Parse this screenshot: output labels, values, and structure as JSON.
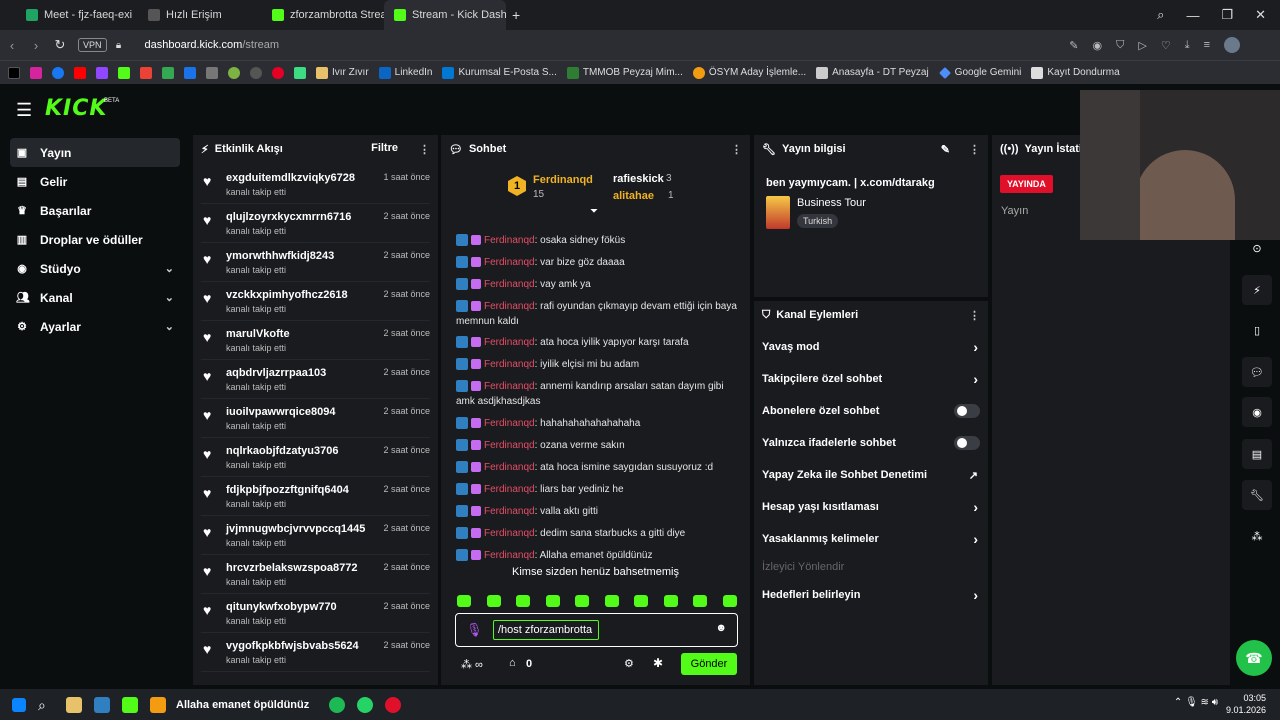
{
  "browser": {
    "tabs": [
      {
        "label": "Meet - fjz-faeq-exi",
        "color": "#1fa463"
      },
      {
        "label": "Hızlı Erişim",
        "color": "#888888"
      },
      {
        "label": "zforzambrotta Stream - W",
        "color": "#53fc18"
      },
      {
        "label": "Stream - Kick Dashboard",
        "color": "#53fc18",
        "active": true
      }
    ],
    "vpn": "VPN",
    "url_host": "dashboard.kick.com",
    "url_path": "/stream",
    "bookmarks": [
      "Ivır Zıvır",
      "LinkedIn",
      "Kurumsal E-Posta S...",
      "TMMOB Peyzaj Mim...",
      "ÖSYM Aday İşlemle...",
      "Anasayfa - DT Peyzaj",
      "Google Gemini",
      "Kayıt Dondurma"
    ]
  },
  "app": {
    "logo": "KICK",
    "beta": "BETA",
    "accent": "#53fc18"
  },
  "sidebar": {
    "items": [
      {
        "label": "Yayın",
        "icon": "video-icon",
        "active": true
      },
      {
        "label": "Gelir",
        "icon": "revenue-icon"
      },
      {
        "label": "Başarılar",
        "icon": "trophy-icon"
      },
      {
        "label": "Droplar ve ödüller",
        "icon": "gift-icon"
      },
      {
        "label": "Stüdyo",
        "icon": "studio-icon",
        "expandable": true
      },
      {
        "label": "Kanal",
        "icon": "people-icon",
        "expandable": true
      },
      {
        "label": "Ayarlar",
        "icon": "gear-icon",
        "expandable": true
      }
    ]
  },
  "events": {
    "title": "Etkinlik Akışı",
    "filter": "Filtre",
    "items": [
      {
        "name": "exgduitemdlkzviqky6728",
        "action": "kanalı takip etti",
        "time": "1 saat önce"
      },
      {
        "name": "qlujlzoyrxkycxmrrn6716",
        "action": "kanalı takip etti",
        "time": "2 saat önce"
      },
      {
        "name": "ymorwthhwfkidj8243",
        "action": "kanalı takip etti",
        "time": "2 saat önce"
      },
      {
        "name": "vzckkxpimhyofhcz2618",
        "action": "kanalı takip etti",
        "time": "2 saat önce"
      },
      {
        "name": "marulVkofte",
        "action": "kanalı takip etti",
        "time": "2 saat önce"
      },
      {
        "name": "aqbdrvljazrrpaa103",
        "action": "kanalı takip etti",
        "time": "2 saat önce"
      },
      {
        "name": "iuoilvpawwrqice8094",
        "action": "kanalı takip etti",
        "time": "2 saat önce"
      },
      {
        "name": "nqlrkaobjfdzatyu3706",
        "action": "kanalı takip etti",
        "time": "2 saat önce"
      },
      {
        "name": "fdjkpbjfpozzftgnifq6404",
        "action": "kanalı takip etti",
        "time": "2 saat önce"
      },
      {
        "name": "jvjmnugwbcjvrvvpccq1445",
        "action": "kanalı takip etti",
        "time": "2 saat önce"
      },
      {
        "name": "hrcvzrbelakswzspoa8772",
        "action": "kanalı takip etti",
        "time": "2 saat önce"
      },
      {
        "name": "qitunykwfxobypw770",
        "action": "kanalı takip etti",
        "time": "2 saat önce"
      },
      {
        "name": "vygofkpkbfwjsbvabs5624",
        "action": "kanalı takip etti",
        "time": "2 saat önce"
      }
    ]
  },
  "chat": {
    "title": "Sohbet",
    "leaderboard": {
      "first": {
        "rank": "1",
        "name": "Ferdinanqd",
        "count": "15"
      },
      "second": {
        "name": "rafieskick",
        "count": "3"
      },
      "third": {
        "name": "alitahae",
        "count": "1"
      }
    },
    "username": "Ferdinanqd",
    "messages": [
      "osaka sidney föküs",
      "var bize göz daaaa",
      "vay amk ya",
      "rafi oyundan çıkmayıp devam ettiği için baya memnun kaldı",
      "ata hoca iyilik yapıyor karşı tarafa",
      "iyilik elçisi mi bu adam",
      "annemi kandırıp arsaları satan dayım gibi amk asdjkhasdjkas",
      "hahahahahahahahaha",
      "ozana verme sakın",
      "ata hoca ismine saygıdan susuyoruz :d",
      "liars bar yediniz he",
      "valla aktı gitti",
      "dedim sana starbucks a gitti diye",
      "Allaha emanet öpüldünüz"
    ],
    "mention_notice": "Kimse sizden henüz bahsetmemiş",
    "input_value": "/host zforzambrotta",
    "points": "0",
    "send": "Gönder"
  },
  "stream_info": {
    "title": "Yayın bilgisi",
    "stream_title": "ben yaymıycam. | x.com/dtarakg",
    "category": "Business Tour",
    "tag": "Turkish"
  },
  "channel_actions": {
    "title": "Kanal Eylemleri",
    "items": [
      {
        "label": "Yavaş mod",
        "kind": "chevron"
      },
      {
        "label": "Takipçilere özel sohbet",
        "kind": "chevron"
      },
      {
        "label": "Abonelere özel sohbet",
        "kind": "toggle"
      },
      {
        "label": "Yalnızca ifadelerle sohbet",
        "kind": "toggle"
      },
      {
        "label": "Yapay Zeka ile Sohbet Denetimi",
        "kind": "external"
      },
      {
        "label": "Hesap yaşı kısıtlaması",
        "kind": "chevron"
      },
      {
        "label": "Yasaklanmış kelimeler",
        "kind": "chevron"
      },
      {
        "label": "İzleyici Yönlendir",
        "kind": "disabled"
      },
      {
        "label": "Hedefleri belirleyin",
        "kind": "chevron"
      }
    ]
  },
  "stats": {
    "title": "Yayın İstatisti",
    "live_badge": "YAYINDA",
    "live_color": "#e0102b",
    "label": "Yayın"
  },
  "taskbar": {
    "media_title": "Allaha emanet öpüldünüz",
    "time": "03:05",
    "date": "9.01.2026"
  }
}
